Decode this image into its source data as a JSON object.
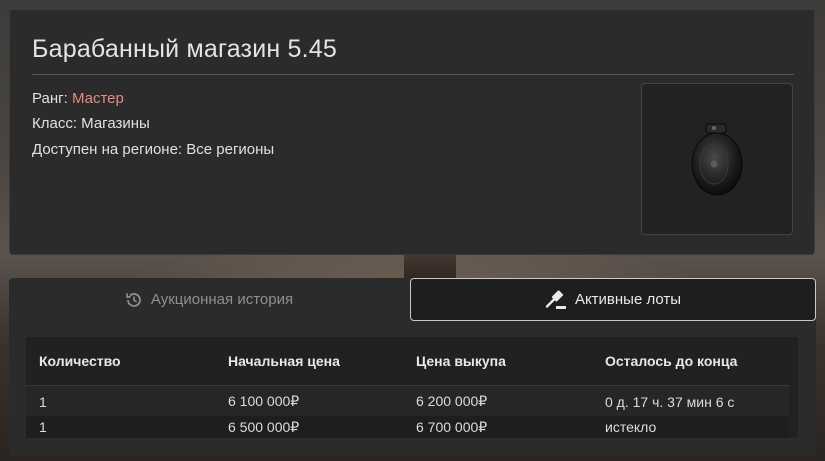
{
  "item": {
    "title": "Барабанный магазин 5.45",
    "rank_label": "Ранг: ",
    "rank_value": "Мастер",
    "rank_color": "#e98a84",
    "class_text": "Класс: Магазины",
    "region_text": "Доступен на регионе: Все регионы",
    "image_icon": "drum-magazine-icon"
  },
  "tabs": [
    {
      "label": "Аукционная история",
      "icon": "history-icon",
      "active": false
    },
    {
      "label": "Активные лоты",
      "icon": "gavel-icon",
      "active": true
    }
  ],
  "table": {
    "headers": [
      "Количество",
      "Начальная цена",
      "Цена выкупа",
      "Осталось до конца"
    ],
    "rows": [
      [
        "1",
        "6 100 000₽",
        "6 200 000₽",
        "0 д. 17 ч. 37 мин 6 с"
      ],
      [
        "1",
        "6 500 000₽",
        "6 700 000₽",
        "истекло"
      ]
    ]
  }
}
